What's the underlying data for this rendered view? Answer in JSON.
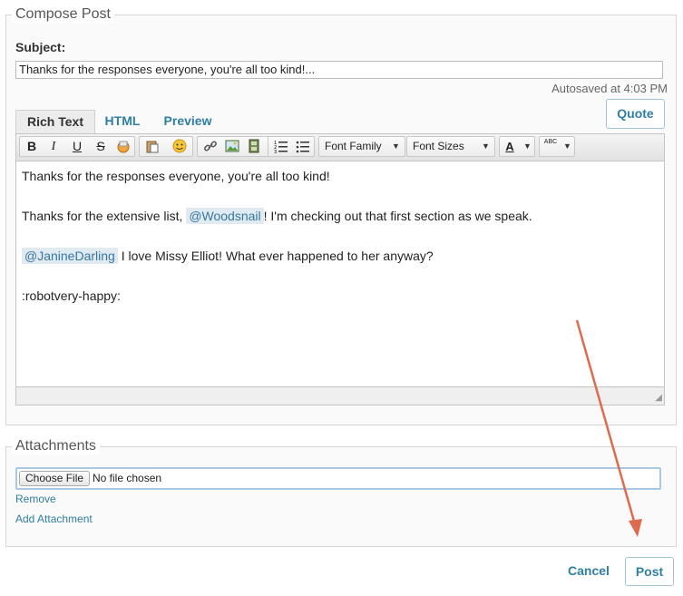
{
  "compose": {
    "legend": "Compose Post",
    "subject_label": "Subject:",
    "subject_value": "Thanks for the responses everyone, you're all too kind!...",
    "autosave": "Autosaved at 4:03 PM",
    "quote_label": "Quote",
    "tabs": [
      {
        "label": "Rich Text",
        "active": true
      },
      {
        "label": "HTML",
        "active": false
      },
      {
        "label": "Preview",
        "active": false
      }
    ],
    "toolbar": {
      "bold": "B",
      "italic": "I",
      "underline": "U",
      "strike": "S",
      "font_family": "Font Family",
      "font_sizes": "Font Sizes",
      "text_color": "A",
      "spellcheck": "ABC"
    },
    "content": {
      "line1": "Thanks for the responses everyone, you're all too kind!",
      "line2_prefix": "Thanks for the extensive list, ",
      "line2_mention": "@Woodsnail",
      "line2_suffix": "! I'm checking out that first section as we speak.",
      "line3_mention": "@JanineDarling",
      "line3_suffix": " I love Missy Elliot! What ever happened to her anyway?",
      "line4": ":robotvery-happy:"
    }
  },
  "attachments": {
    "legend": "Attachments",
    "choose_file": "Choose File",
    "file_status": "No file chosen",
    "remove": "Remove",
    "add_attachment": "Add Attachment"
  },
  "actions": {
    "cancel": "Cancel",
    "post": "Post"
  },
  "colors": {
    "link": "#2f7fa3",
    "mention_bg": "#dfeaf1",
    "annotation_arrow": "#e06a4e"
  }
}
